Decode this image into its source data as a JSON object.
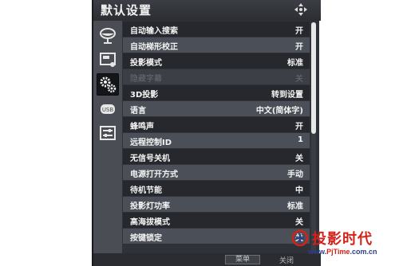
{
  "window": {
    "title": "默认设置"
  },
  "sidebar": {
    "items": [
      {
        "icon": "satellite-dish-icon",
        "active": false
      },
      {
        "icon": "picture-icon",
        "active": false
      },
      {
        "icon": "gears-icon",
        "active": true
      },
      {
        "icon": "usb-icon",
        "active": false
      },
      {
        "icon": "sliders-icon",
        "active": false
      }
    ]
  },
  "settings": [
    {
      "label": "自动输入搜索",
      "value": "开",
      "style": "dark"
    },
    {
      "label": "自动梯形校正",
      "value": "开",
      "style": "light"
    },
    {
      "label": "投影模式",
      "value": "标准",
      "style": "dark"
    },
    {
      "label": "隐藏字幕",
      "value": "关",
      "style": "disabled"
    },
    {
      "label": "3D投影",
      "value": "转到设置",
      "style": "dark"
    },
    {
      "label": "语言",
      "value": "中文(简体字)",
      "style": "light"
    },
    {
      "label": "蜂鸣声",
      "value": "开",
      "style": "dark"
    },
    {
      "label": "远程控制ID",
      "value": "1",
      "style": "light"
    },
    {
      "label": "无信号关机",
      "value": "关",
      "style": "dark"
    },
    {
      "label": "电源打开方式",
      "value": "手动",
      "style": "light"
    },
    {
      "label": "待机节能",
      "value": "中",
      "style": "dark"
    },
    {
      "label": "投影灯功率",
      "value": "标准",
      "style": "light"
    },
    {
      "label": "高海拔模式",
      "value": "关",
      "style": "dark"
    },
    {
      "label": "按键锁定",
      "value": "关",
      "style": "light"
    }
  ],
  "footer": {
    "menu_label": "菜单",
    "exit_label": "关闭"
  },
  "watermark": {
    "brand": "投影时代",
    "url_prefix": "www.",
    "url_brand": "PjTime",
    "url_suffix": ".com.cn"
  },
  "colors": {
    "panel": "#2f3238",
    "row_light": "#4b4f57",
    "row_dark": "#26282d",
    "watermark_red": "#d2231b"
  }
}
